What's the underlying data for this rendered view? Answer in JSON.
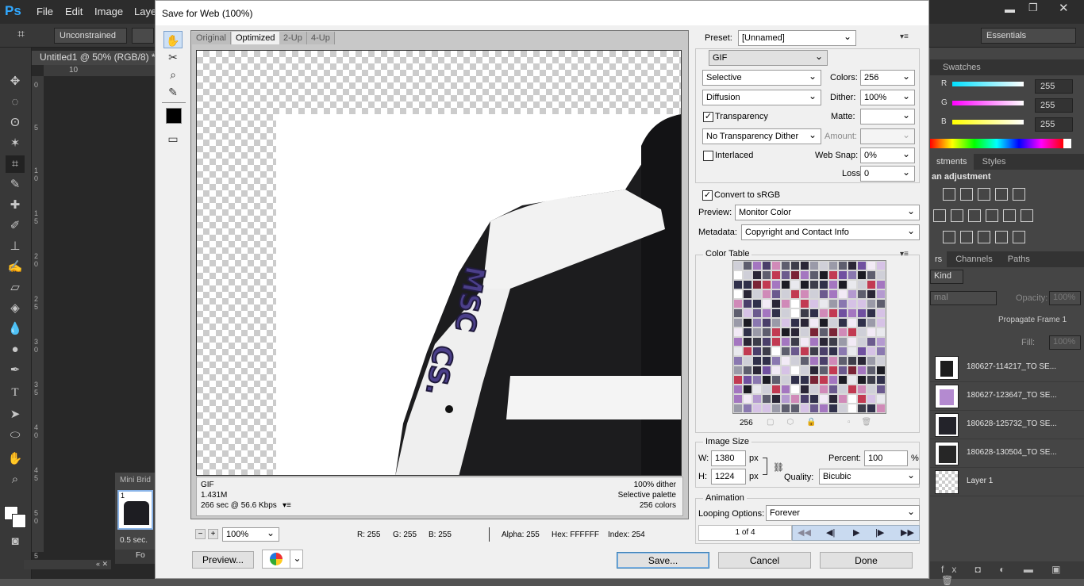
{
  "ps": {
    "logo": "Ps",
    "menus": [
      "File",
      "Edit",
      "Image",
      "Layer"
    ],
    "options": {
      "constraint": "Unconstrained",
      "workspace": "Essentials"
    },
    "doc_tab": "Untitled1 @ 50% (RGB/8) *",
    "ruler_top": "10",
    "ruler_left": [
      "0",
      "5",
      "1 0",
      "1 5",
      "2 0",
      "2 5",
      "3 0",
      "3 5",
      "4 0",
      "4 5",
      "5 0",
      "5 5"
    ],
    "mini_bridge": {
      "label": "Mini Brid",
      "thumb_num": "1",
      "time": "0.5 sec."
    },
    "bottom_label": "Fo"
  },
  "right_panels": {
    "swatches_tab": "Swatches",
    "rgb": [
      {
        "label": "R",
        "value": "255",
        "color": "#00e0ff"
      },
      {
        "label": "G",
        "value": "255",
        "color": "#ff00ff"
      },
      {
        "label": "B",
        "value": "255",
        "color": "#ffff00"
      }
    ],
    "adjust_tabs": [
      "stments",
      "Styles"
    ],
    "adjust_title": "an adjustment",
    "layers_tabs": [
      "rs",
      "Channels",
      "Paths"
    ],
    "kind": "Kind",
    "blend": "mal",
    "opacity_label": "Opacity:",
    "opacity_value": "100%",
    "propagate": "Propagate Frame 1",
    "fill_label": "Fill:",
    "fill_value": "100%",
    "layers": [
      {
        "name": "180627-114217_TO SE...",
        "color": "#1c1c1c"
      },
      {
        "name": "180627-123647_TO SE...",
        "color": "#b48ad0"
      },
      {
        "name": "180628-125732_TO SE...",
        "color": "#23232a"
      },
      {
        "name": "180628-130504_TO SE...",
        "color": "#262626"
      },
      {
        "name": "Layer 1",
        "color": "checker"
      }
    ]
  },
  "dialog": {
    "title": "Save for Web (100%)",
    "view_tabs": [
      "Original",
      "Optimized",
      "2-Up",
      "4-Up"
    ],
    "active_tab": "Optimized",
    "info_left": [
      "GIF",
      "1.431M",
      "266 sec @ 56.6 Kbps"
    ],
    "info_right": [
      "100% dither",
      "Selective palette",
      "256 colors"
    ],
    "zoom": "100%",
    "readout": {
      "r": "R: 255",
      "g": "G: 255",
      "b": "B: 255",
      "alpha": "Alpha: 255",
      "hex": "Hex: FFFFFF",
      "index": "Index: 254"
    },
    "preset_label": "Preset:",
    "preset_value": "[Unnamed]",
    "format": "GIF",
    "reduction": "Selective",
    "dither_algo": "Diffusion",
    "colors_label": "Colors:",
    "colors_value": "256",
    "dither_label": "Dither:",
    "dither_value": "100%",
    "transparency_label": "Transparency",
    "matte_label": "Matte:",
    "transparency_dither": "No Transparency Dither",
    "amount_label": "Amount:",
    "interlaced_label": "Interlaced",
    "websnap_label": "Web Snap:",
    "websnap_value": "0%",
    "lossy_label": "Lossy:",
    "lossy_value": "0",
    "convert_srgb": "Convert to sRGB",
    "preview_label": "Preview:",
    "preview_value": "Monitor Color",
    "metadata_label": "Metadata:",
    "metadata_value": "Copyright and Contact Info",
    "color_table_label": "Color Table",
    "color_count": "256",
    "image_size_label": "Image Size",
    "w_label": "W:",
    "w_value": "1380",
    "h_label": "H:",
    "h_value": "1224",
    "px": "px",
    "percent_label": "Percent:",
    "percent_value": "100",
    "percent_unit": "%",
    "quality_label": "Quality:",
    "quality_value": "Bicubic",
    "animation_label": "Animation",
    "looping_label": "Looping Options:",
    "looping_value": "Forever",
    "frame_counter": "1 of 4",
    "buttons": {
      "preview": "Preview...",
      "save": "Save...",
      "cancel": "Cancel",
      "done": "Done"
    }
  }
}
